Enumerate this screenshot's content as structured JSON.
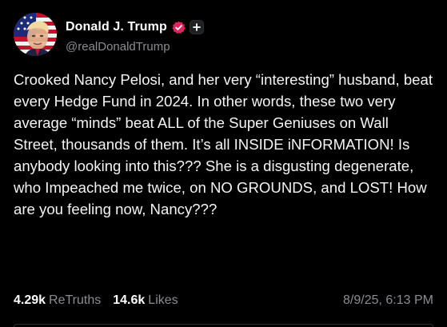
{
  "author": {
    "display_name": "Donald J. Trump",
    "handle": "@realDonaldTrump",
    "verified": true,
    "verified_color": "#e0245e",
    "avatar_icon": "flag-portrait-avatar",
    "follow_icon": "plus-icon"
  },
  "post": {
    "text": "Crooked Nancy Pelosi, and her very “interesting” husband, beat every Hedge Fund in 2024. In other words, these two very average “minds” beat ALL of the Super Geniuses on Wall Street, thousands of them. It’s all INSIDE iNFORMATION! Is anybody looking into this??? She is a disgusting degenerate, who Impeached me twice, on NO GROUNDS, and LOST! How are you feeling now, Nancy???"
  },
  "stats": {
    "retruths_count": "4.29k",
    "retruths_label": "ReTruths",
    "likes_count": "14.6k",
    "likes_label": "Likes",
    "timestamp": "8/9/25, 6:13 PM"
  },
  "colors": {
    "background": "#000000",
    "text_primary": "#ffffff",
    "text_secondary": "#8b8b93"
  }
}
